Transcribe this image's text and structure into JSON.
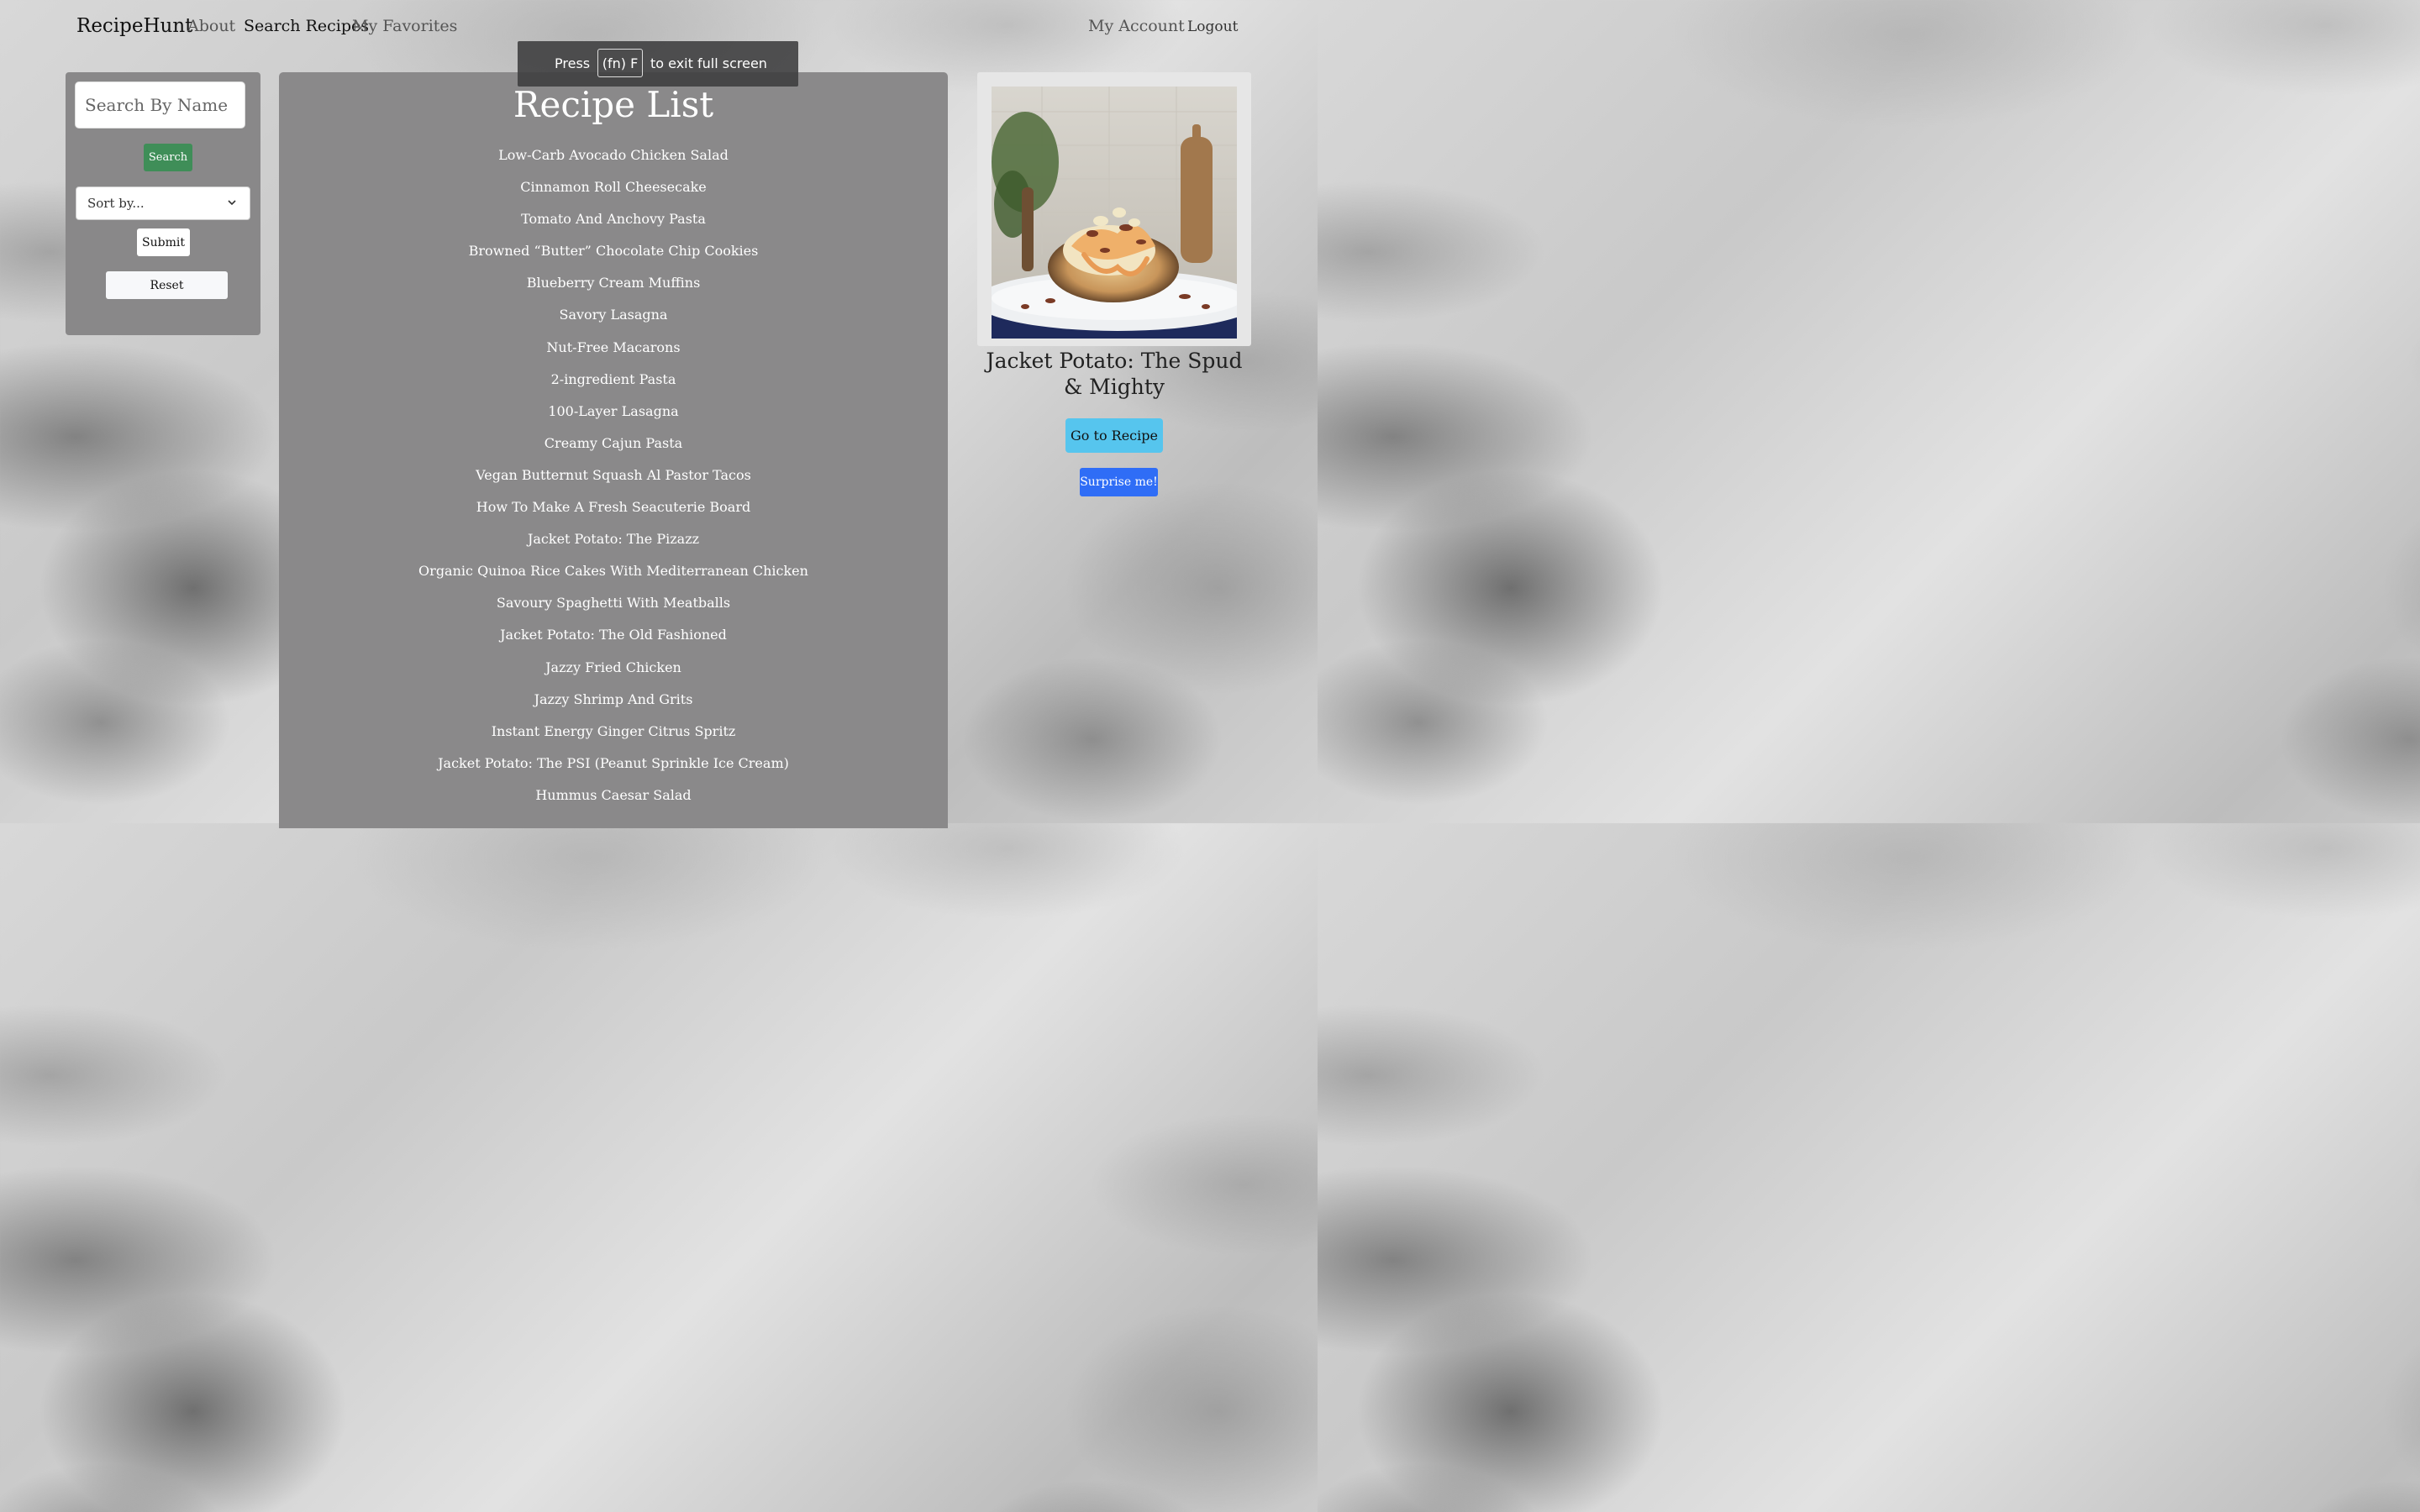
{
  "navbar": {
    "brand": "RecipeHunt",
    "links": {
      "about": "About",
      "search_recipes": "Search Recipes",
      "my_favorites": "My Favorites"
    },
    "account": "My Account",
    "logout": "Logout",
    "active_link": "Search Recipes"
  },
  "fullscreen_notice": {
    "press": "Press",
    "key": "(fn) F",
    "message": "to exit full screen"
  },
  "search_panel": {
    "search_placeholder": "Search By Name",
    "search_button": "Search",
    "sort_selected": "Sort by...",
    "submit_button": "Submit",
    "reset_button": "Reset"
  },
  "recipe_list": {
    "title": "Recipe List",
    "items": [
      "Low-Carb Avocado Chicken Salad",
      "Cinnamon Roll Cheesecake",
      "Tomato And Anchovy Pasta",
      "Browned “Butter” Chocolate Chip Cookies",
      "Blueberry Cream Muffins",
      "Savory Lasagna",
      "Nut-Free Macarons",
      "2-ingredient Pasta",
      "100-Layer Lasagna",
      "Creamy Cajun Pasta",
      "Vegan Butternut Squash Al Pastor Tacos",
      "How To Make A Fresh Seacuterie Board",
      "Jacket Potato: The Pizazz",
      "Organic Quinoa Rice Cakes With Mediterranean Chicken",
      "Savoury Spaghetti With Meatballs",
      "Jacket Potato: The Old Fashioned",
      "Jazzy Fried Chicken",
      "Jazzy Shrimp And Grits",
      "Instant Energy Ginger Citrus Spritz",
      "Jacket Potato: The PSI (Peanut Sprinkle Ice Cream)",
      "Hummus Caesar Salad"
    ]
  },
  "featured": {
    "title": "Jacket Potato: The Spud & Mighty",
    "go_button": "Go to Recipe",
    "surprise_button": "Surprise me!"
  },
  "colors": {
    "search_button": "#3f8e58",
    "go_button": "#56c5ee",
    "surprise_button": "#2f6df6",
    "panel": "#8a898a"
  }
}
